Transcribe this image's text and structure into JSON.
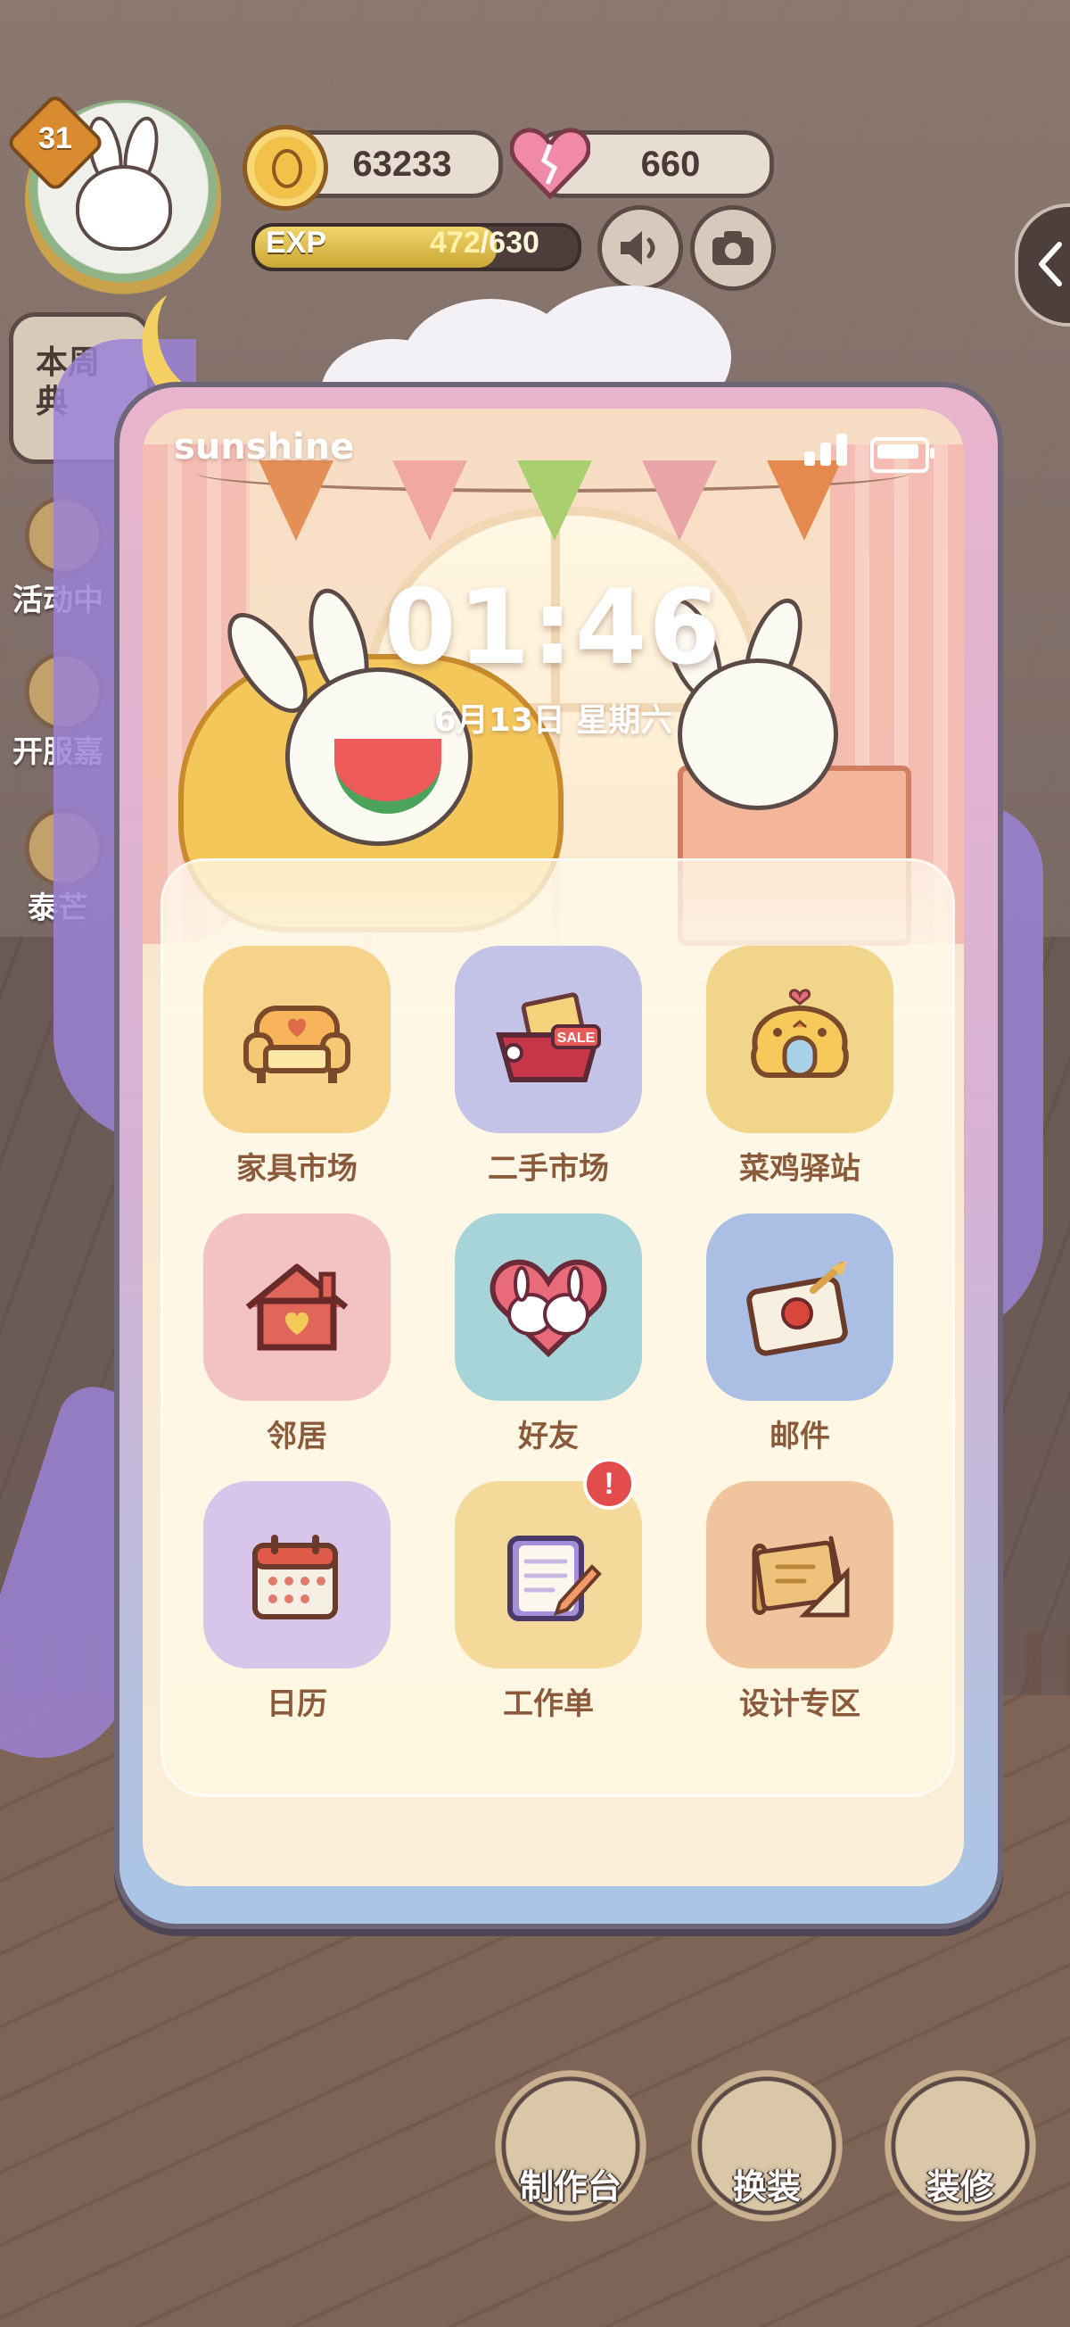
{
  "hud": {
    "level": "31",
    "coins": "63233",
    "hearts": "660",
    "exp_label": "EXP",
    "exp_current": "472",
    "exp_max": "/630",
    "exp_progress": 0.749
  },
  "side_menu": {
    "weekly": "本周典",
    "items": [
      "活动中",
      "开服嘉",
      "泰芒"
    ]
  },
  "bottom_bar": {
    "craft": "制作台",
    "dress": "换装",
    "decorate": "装修"
  },
  "phone": {
    "owner_name": "sunshine",
    "time": "01:46",
    "date": "6月13日 星期六",
    "apps": [
      {
        "label": "家具市场",
        "icon": "armchair-icon",
        "color": "#f5d38a"
      },
      {
        "label": "二手市场",
        "icon": "sale-basket-icon",
        "color": "#c3c3e7"
      },
      {
        "label": "菜鸡驿站",
        "icon": "chick-station-icon",
        "color": "#f1d58a"
      },
      {
        "label": "邻居",
        "icon": "house-icon",
        "color": "#f3c3c3"
      },
      {
        "label": "好友",
        "icon": "bunny-heart-icon",
        "color": "#a7d4d8"
      },
      {
        "label": "邮件",
        "icon": "envelope-icon",
        "color": "#aabfe3"
      },
      {
        "label": "日历",
        "icon": "calendar-icon",
        "color": "#d8c6ea"
      },
      {
        "label": "工作单",
        "icon": "worksheet-icon",
        "color": "#f5d99a",
        "badge": "!"
      },
      {
        "label": "设计专区",
        "icon": "blueprint-icon",
        "color": "#f0c49c"
      }
    ]
  }
}
